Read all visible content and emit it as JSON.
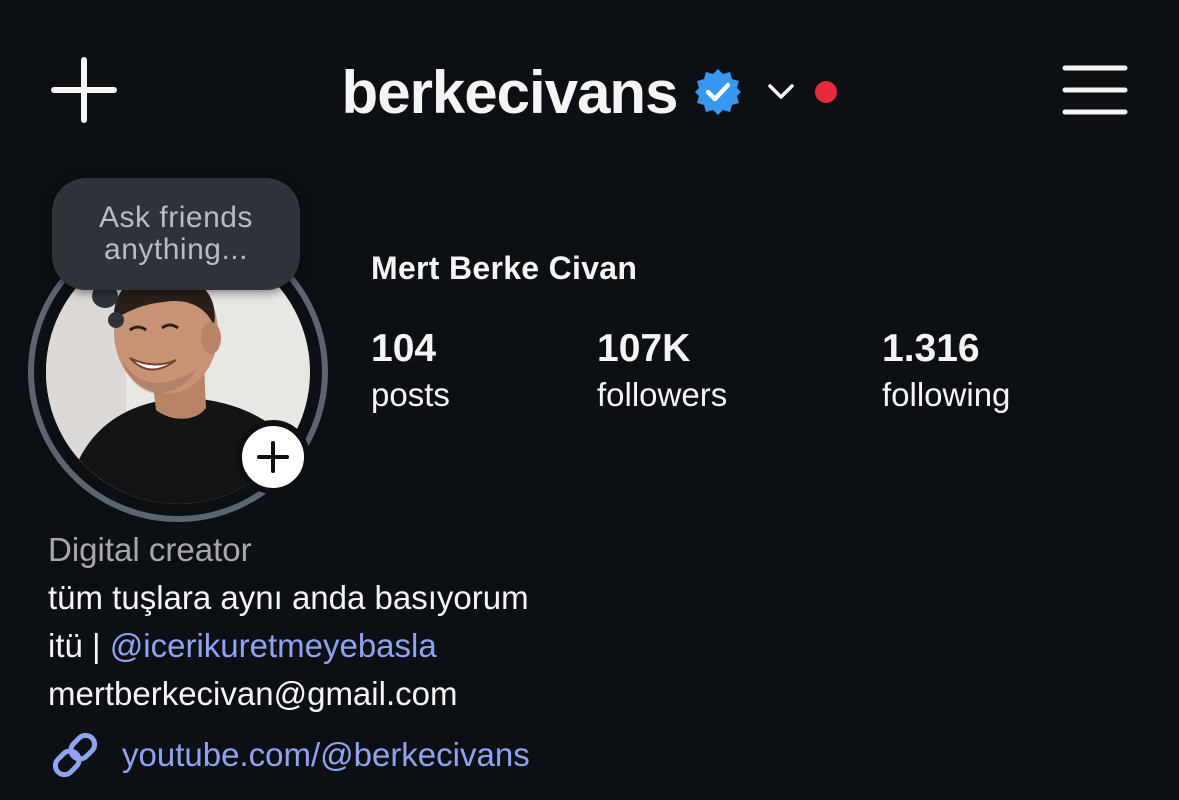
{
  "header": {
    "username": "berkecivans",
    "verified_color": "#3897f0",
    "notification_dot_color": "#e52b3a"
  },
  "note": {
    "line1": "Ask friends",
    "line2": "anything..."
  },
  "profile": {
    "full_name": "Mert Berke Civan",
    "stats": [
      {
        "value": "104",
        "label": "posts"
      },
      {
        "value": "107K",
        "label": "followers"
      },
      {
        "value": "1.316",
        "label": "following"
      }
    ]
  },
  "bio": {
    "category": "Digital creator",
    "line1": "tüm tuşlara aynı anda basıyorum",
    "line2_prefix": "itü | ",
    "line2_mention": "@icerikuretmeyebasla",
    "line3": "mertberkecivan@gmail.com",
    "link": "youtube.com/@berkecivans"
  },
  "colors": {
    "background": "#0c1014",
    "link": "#8fa3f0",
    "muted": "#a8a8a8"
  }
}
